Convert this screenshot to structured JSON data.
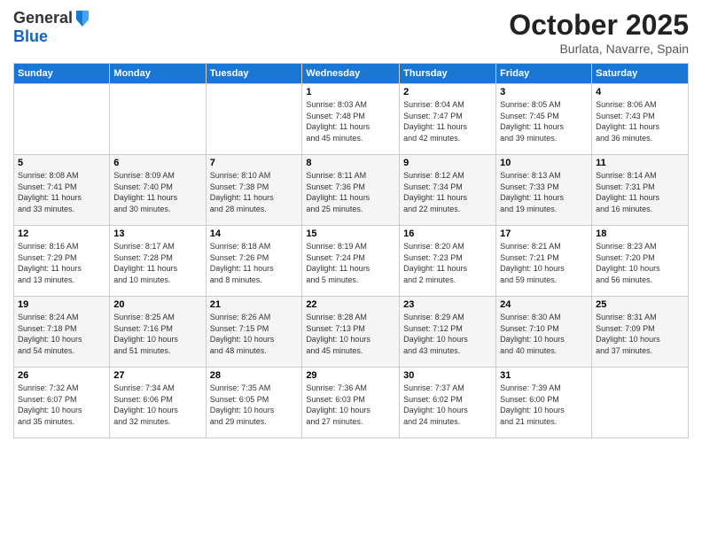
{
  "header": {
    "logo_line1": "General",
    "logo_line2": "Blue",
    "month_title": "October 2025",
    "location": "Burlata, Navarre, Spain"
  },
  "days_of_week": [
    "Sunday",
    "Monday",
    "Tuesday",
    "Wednesday",
    "Thursday",
    "Friday",
    "Saturday"
  ],
  "weeks": [
    [
      {
        "day": "",
        "info": ""
      },
      {
        "day": "",
        "info": ""
      },
      {
        "day": "",
        "info": ""
      },
      {
        "day": "1",
        "info": "Sunrise: 8:03 AM\nSunset: 7:48 PM\nDaylight: 11 hours\nand 45 minutes."
      },
      {
        "day": "2",
        "info": "Sunrise: 8:04 AM\nSunset: 7:47 PM\nDaylight: 11 hours\nand 42 minutes."
      },
      {
        "day": "3",
        "info": "Sunrise: 8:05 AM\nSunset: 7:45 PM\nDaylight: 11 hours\nand 39 minutes."
      },
      {
        "day": "4",
        "info": "Sunrise: 8:06 AM\nSunset: 7:43 PM\nDaylight: 11 hours\nand 36 minutes."
      }
    ],
    [
      {
        "day": "5",
        "info": "Sunrise: 8:08 AM\nSunset: 7:41 PM\nDaylight: 11 hours\nand 33 minutes."
      },
      {
        "day": "6",
        "info": "Sunrise: 8:09 AM\nSunset: 7:40 PM\nDaylight: 11 hours\nand 30 minutes."
      },
      {
        "day": "7",
        "info": "Sunrise: 8:10 AM\nSunset: 7:38 PM\nDaylight: 11 hours\nand 28 minutes."
      },
      {
        "day": "8",
        "info": "Sunrise: 8:11 AM\nSunset: 7:36 PM\nDaylight: 11 hours\nand 25 minutes."
      },
      {
        "day": "9",
        "info": "Sunrise: 8:12 AM\nSunset: 7:34 PM\nDaylight: 11 hours\nand 22 minutes."
      },
      {
        "day": "10",
        "info": "Sunrise: 8:13 AM\nSunset: 7:33 PM\nDaylight: 11 hours\nand 19 minutes."
      },
      {
        "day": "11",
        "info": "Sunrise: 8:14 AM\nSunset: 7:31 PM\nDaylight: 11 hours\nand 16 minutes."
      }
    ],
    [
      {
        "day": "12",
        "info": "Sunrise: 8:16 AM\nSunset: 7:29 PM\nDaylight: 11 hours\nand 13 minutes."
      },
      {
        "day": "13",
        "info": "Sunrise: 8:17 AM\nSunset: 7:28 PM\nDaylight: 11 hours\nand 10 minutes."
      },
      {
        "day": "14",
        "info": "Sunrise: 8:18 AM\nSunset: 7:26 PM\nDaylight: 11 hours\nand 8 minutes."
      },
      {
        "day": "15",
        "info": "Sunrise: 8:19 AM\nSunset: 7:24 PM\nDaylight: 11 hours\nand 5 minutes."
      },
      {
        "day": "16",
        "info": "Sunrise: 8:20 AM\nSunset: 7:23 PM\nDaylight: 11 hours\nand 2 minutes."
      },
      {
        "day": "17",
        "info": "Sunrise: 8:21 AM\nSunset: 7:21 PM\nDaylight: 10 hours\nand 59 minutes."
      },
      {
        "day": "18",
        "info": "Sunrise: 8:23 AM\nSunset: 7:20 PM\nDaylight: 10 hours\nand 56 minutes."
      }
    ],
    [
      {
        "day": "19",
        "info": "Sunrise: 8:24 AM\nSunset: 7:18 PM\nDaylight: 10 hours\nand 54 minutes."
      },
      {
        "day": "20",
        "info": "Sunrise: 8:25 AM\nSunset: 7:16 PM\nDaylight: 10 hours\nand 51 minutes."
      },
      {
        "day": "21",
        "info": "Sunrise: 8:26 AM\nSunset: 7:15 PM\nDaylight: 10 hours\nand 48 minutes."
      },
      {
        "day": "22",
        "info": "Sunrise: 8:28 AM\nSunset: 7:13 PM\nDaylight: 10 hours\nand 45 minutes."
      },
      {
        "day": "23",
        "info": "Sunrise: 8:29 AM\nSunset: 7:12 PM\nDaylight: 10 hours\nand 43 minutes."
      },
      {
        "day": "24",
        "info": "Sunrise: 8:30 AM\nSunset: 7:10 PM\nDaylight: 10 hours\nand 40 minutes."
      },
      {
        "day": "25",
        "info": "Sunrise: 8:31 AM\nSunset: 7:09 PM\nDaylight: 10 hours\nand 37 minutes."
      }
    ],
    [
      {
        "day": "26",
        "info": "Sunrise: 7:32 AM\nSunset: 6:07 PM\nDaylight: 10 hours\nand 35 minutes."
      },
      {
        "day": "27",
        "info": "Sunrise: 7:34 AM\nSunset: 6:06 PM\nDaylight: 10 hours\nand 32 minutes."
      },
      {
        "day": "28",
        "info": "Sunrise: 7:35 AM\nSunset: 6:05 PM\nDaylight: 10 hours\nand 29 minutes."
      },
      {
        "day": "29",
        "info": "Sunrise: 7:36 AM\nSunset: 6:03 PM\nDaylight: 10 hours\nand 27 minutes."
      },
      {
        "day": "30",
        "info": "Sunrise: 7:37 AM\nSunset: 6:02 PM\nDaylight: 10 hours\nand 24 minutes."
      },
      {
        "day": "31",
        "info": "Sunrise: 7:39 AM\nSunset: 6:00 PM\nDaylight: 10 hours\nand 21 minutes."
      },
      {
        "day": "",
        "info": ""
      }
    ]
  ]
}
